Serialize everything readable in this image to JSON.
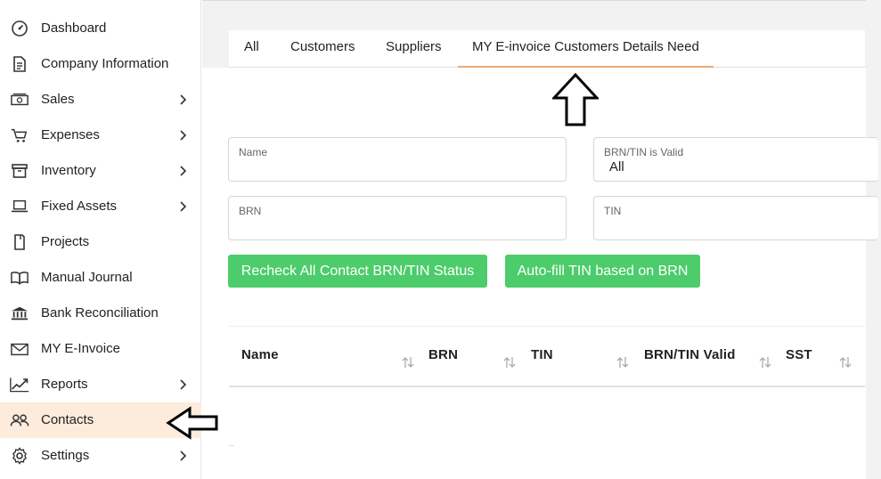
{
  "sidebar": {
    "items": [
      {
        "label": "Dashboard",
        "icon": "dashboard-icon",
        "chevron": false
      },
      {
        "label": "Company Information",
        "icon": "document-icon",
        "chevron": false
      },
      {
        "label": "Sales",
        "icon": "cash-icon",
        "chevron": true
      },
      {
        "label": "Expenses",
        "icon": "cart-icon",
        "chevron": true
      },
      {
        "label": "Inventory",
        "icon": "box-icon",
        "chevron": true
      },
      {
        "label": "Fixed Assets",
        "icon": "laptop-icon",
        "chevron": true
      },
      {
        "label": "Projects",
        "icon": "clipboard-icon",
        "chevron": false
      },
      {
        "label": "Manual Journal",
        "icon": "book-icon",
        "chevron": false
      },
      {
        "label": "Bank Reconciliation",
        "icon": "bank-icon",
        "chevron": false
      },
      {
        "label": "MY E-Invoice",
        "icon": "envelope-icon",
        "chevron": false
      },
      {
        "label": "Reports",
        "icon": "chart-icon",
        "chevron": true
      },
      {
        "label": "Contacts",
        "icon": "contacts-icon",
        "chevron": false,
        "active": true
      },
      {
        "label": "Settings",
        "icon": "gear-icon",
        "chevron": true
      }
    ]
  },
  "tabs": [
    {
      "label": "All"
    },
    {
      "label": "Customers"
    },
    {
      "label": "Suppliers"
    },
    {
      "label": "MY E-invoice Customers Details Need",
      "active": true
    }
  ],
  "filters": {
    "name": {
      "label": "Name",
      "value": ""
    },
    "brn_tin_valid": {
      "label": "BRN/TIN is Valid",
      "value": "All"
    },
    "brn": {
      "label": "BRN",
      "value": ""
    },
    "tin": {
      "label": "TIN",
      "value": ""
    }
  },
  "actions": {
    "recheck_label": "Recheck All Contact BRN/TIN Status",
    "autofill_label": "Auto-fill TIN based on BRN"
  },
  "table": {
    "columns": [
      "Name",
      "BRN",
      "TIN",
      "BRN/TIN Valid",
      "SST"
    ]
  },
  "colors": {
    "accent_green": "#4ccc6a",
    "tab_underline": "#f0a872",
    "active_nav_bg": "#fdebdc"
  }
}
